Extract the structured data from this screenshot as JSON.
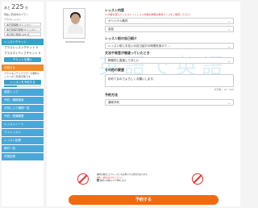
{
  "sidebar": {
    "remain_label": "あと",
    "remain_value": "225",
    "remain_unit": "分",
    "plan_status_line": "現在ご利用中のプラン",
    "plan_name": "プラスレッスン",
    "chips": [
      "本日受講数 0 レッスン",
      "本日受講可能数 0 レッスン",
      "本日残り時間 225 分"
    ],
    "lesson_ticket_header": "レッスンチケット",
    "plus_lesson_ticket": "プラスレッスンチケット",
    "plus_lesson_ticket_count": "0",
    "plus_netive_ticket": "プラスネイティブチケット",
    "plus_netive_ticket_count": "0",
    "buy_ticket_button": "チケットを購入",
    "announcement_header": "お知らせ",
    "announcement_text": "プラスネイティブプランの無料レッスンがご利用可能です",
    "reserve_button": "レッスンを予約する",
    "progress": 0.35,
    "nav_items": [
      "英語トップ",
      "予約・講師検索",
      "お気に入り講師一覧",
      "予約・受講履歴",
      "レッスンノート",
      "マイレッスン",
      "レッスン記録",
      "教材一覧",
      "学習記録"
    ]
  },
  "form": {
    "lesson_content_label": "レッスン内容",
    "lesson_content_note": "※ 内容を選んでください（レッスン内容の詳細は教材ページをご確認ください）",
    "material_value": "オリジナル教材",
    "level_value": "会話",
    "self_intro_label": "レッスン前の自己紹介",
    "self_intro_value": "レッスン前にお互いの自己紹介の時間を設けて…",
    "correction_label": "文法や発音が間違っていたとき",
    "correction_value": "積極的に直接してほしい",
    "other_request_label": "その他の要望",
    "other_request_value": "初めてなのでよろしくお願いします。",
    "char_count": "文字数：16 / 200",
    "reservation_method_label": "予約方法",
    "reservation_method_value": "通常予約",
    "notice_text": "講師の都合によりレッスンをお断りする場合があります。",
    "notice_red": "撮影・録音はお控えください",
    "checkbox_label": "確認し同意の上で予約します",
    "submit_label": "予約する"
  },
  "watermark_text": "英語で英語"
}
